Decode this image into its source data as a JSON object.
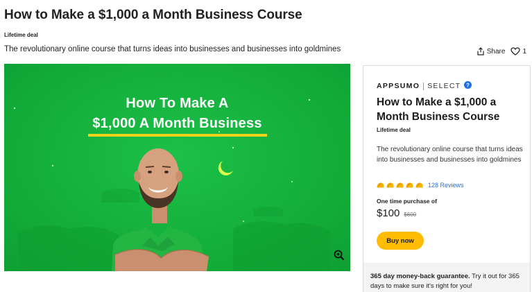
{
  "page": {
    "title": "How to Make a $1,000 a Month Business Course",
    "deal_tag": "Lifetime deal",
    "subtitle": "The revolutionary online course that turns ideas into businesses and businesses into goldmines"
  },
  "actions": {
    "share_label": "Share",
    "like_count": "1"
  },
  "hero": {
    "line1": "How To Make A",
    "line2": "$1,000 A Month Business",
    "background_color": "#16b33e",
    "underline_color": "#f1d11a"
  },
  "card": {
    "brand_name": "APPSUMO",
    "brand_tier": "SELECT",
    "title": "How to Make a $1,000 a Month Business Course",
    "deal_tag": "Lifetime deal",
    "description": "The revolutionary online course that turns ideas into businesses and businesses into goldmines",
    "rating_tacos": 5,
    "reviews_label": "128 Reviews",
    "one_time_label": "One time purchase of",
    "price": "$100",
    "old_price": "$600",
    "buy_label": "Buy now",
    "guarantee_bold": "365 day money-back guarantee.",
    "guarantee_text": " Try it out for 365 days to make sure it's right for you!",
    "accent_color": "#ffbc00",
    "link_color": "#2a6fdb"
  }
}
